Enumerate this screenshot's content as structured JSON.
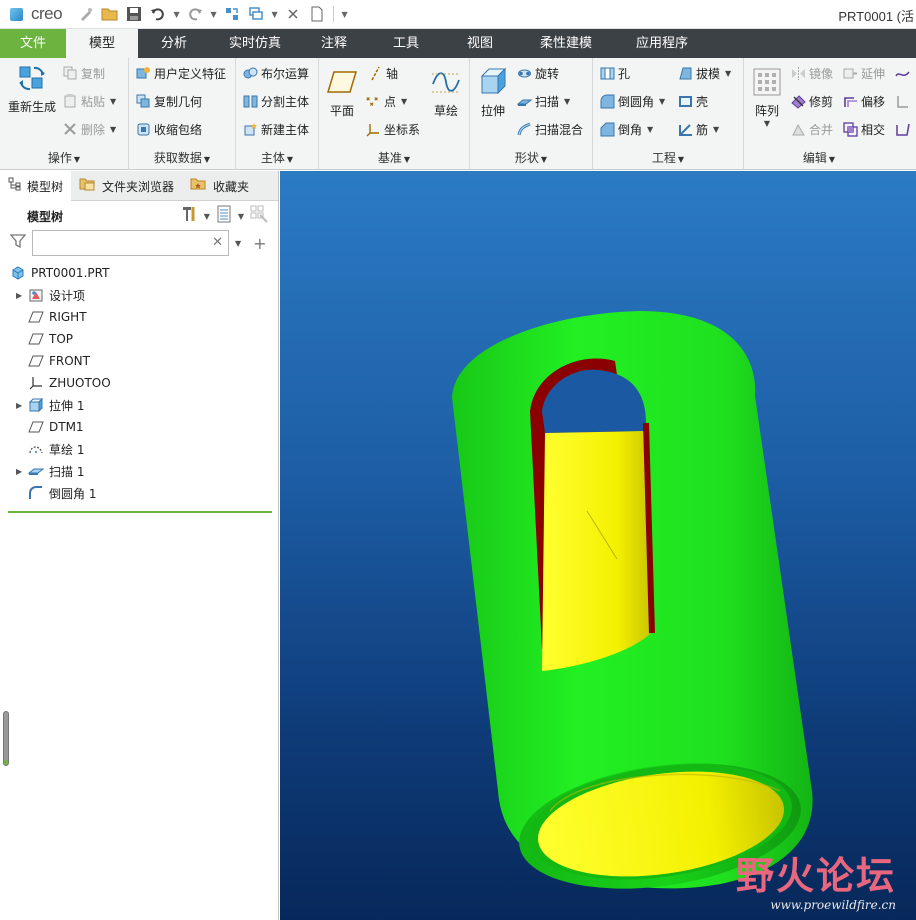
{
  "app": {
    "logo": "creo",
    "window_title": "PRT0001 (活"
  },
  "tabs": [
    "文件",
    "模型",
    "分析",
    "实时仿真",
    "注释",
    "工具",
    "视图",
    "柔性建模",
    "应用程序"
  ],
  "ribbon": {
    "ops": {
      "label": "操作",
      "regen": "重新生成",
      "copy": "复制",
      "paste": "粘贴",
      "delete": "删除"
    },
    "getdata": {
      "label": "获取数据",
      "udf": "用户定义特征",
      "copygeom": "复制几何",
      "shrinkwrap": "收缩包络"
    },
    "body": {
      "label": "主体",
      "boolean": "布尔运算",
      "split": "分割主体",
      "newbody": "新建主体"
    },
    "datum": {
      "label": "基准",
      "plane": "平面",
      "axis": "轴",
      "point": "点",
      "csys": "坐标系",
      "sketch": "草绘"
    },
    "shapes": {
      "label": "形状",
      "extrude": "拉伸",
      "revolve": "旋转",
      "sweep": "扫描",
      "sweptblend": "扫描混合"
    },
    "engineering": {
      "label": "工程",
      "hole": "孔",
      "round": "倒圆角",
      "chamfer": "倒角",
      "draft": "拔模",
      "shell": "壳",
      "rib": "筋"
    },
    "editing": {
      "label": "编辑",
      "pattern": "阵列",
      "mirror": "镜像",
      "trim": "修剪",
      "merge": "合并",
      "extend": "延伸",
      "offset": "偏移",
      "intersect": "相交"
    }
  },
  "panel": {
    "tabs": [
      "模型树",
      "文件夹浏览器",
      "收藏夹"
    ],
    "title": "模型树",
    "search_value": "",
    "tree": [
      {
        "label": "PRT0001.PRT",
        "icon": "part-icon",
        "expandable": false,
        "indent": 0
      },
      {
        "label": "设计项",
        "icon": "design-items-icon",
        "expandable": true,
        "indent": 1
      },
      {
        "label": "RIGHT",
        "icon": "datum-plane-icon",
        "expandable": false,
        "indent": 1
      },
      {
        "label": "TOP",
        "icon": "datum-plane-icon",
        "expandable": false,
        "indent": 1
      },
      {
        "label": "FRONT",
        "icon": "datum-plane-icon",
        "expandable": false,
        "indent": 1
      },
      {
        "label": "ZHUOTOO",
        "icon": "csys-icon",
        "expandable": false,
        "indent": 1
      },
      {
        "label": "拉伸 1",
        "icon": "extrude-icon",
        "expandable": true,
        "indent": 1
      },
      {
        "label": "DTM1",
        "icon": "datum-plane-icon",
        "expandable": false,
        "indent": 1
      },
      {
        "label": "草绘 1",
        "icon": "sketch-icon",
        "expandable": false,
        "indent": 1
      },
      {
        "label": "扫描 1",
        "icon": "sweep-icon",
        "expandable": true,
        "indent": 1
      },
      {
        "label": "倒圆角 1",
        "icon": "round-icon",
        "expandable": false,
        "indent": 1
      }
    ]
  },
  "colors": {
    "accent_green": "#6db33f",
    "tab_bar": "#3c4146",
    "model_body": "#1ee01e",
    "model_inner": "#f2f200",
    "model_cut_wall": "#8b0000"
  },
  "watermark": {
    "main": "野火论坛",
    "sub": "www.proewildfire.cn"
  }
}
